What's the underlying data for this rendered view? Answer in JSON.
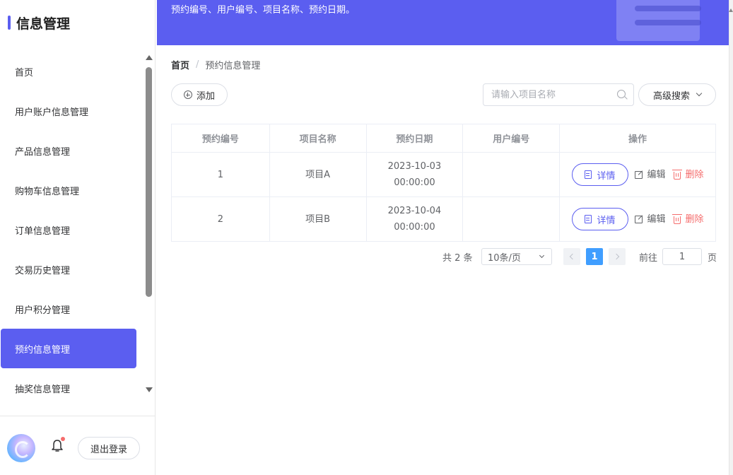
{
  "sidebar": {
    "title": "信息管理",
    "items": [
      {
        "label": "首页",
        "active": false
      },
      {
        "label": "用户账户信息管理",
        "active": false
      },
      {
        "label": "产品信息管理",
        "active": false
      },
      {
        "label": "购物车信息管理",
        "active": false
      },
      {
        "label": "订单信息管理",
        "active": false
      },
      {
        "label": "交易历史管理",
        "active": false
      },
      {
        "label": "用户积分管理",
        "active": false
      },
      {
        "label": "预约信息管理",
        "active": true
      },
      {
        "label": "抽奖信息管理",
        "active": false
      }
    ],
    "footer": {
      "logout_label": "退出登录"
    }
  },
  "banner": {
    "text": "预约编号、用户编号、项目名称、预约日期。"
  },
  "breadcrumb": {
    "home": "首页",
    "separator": "/",
    "current": "预约信息管理"
  },
  "toolbar": {
    "add_label": "添加",
    "search_placeholder": "请输入项目名称",
    "search_value": "",
    "advanced_label": "高级搜索"
  },
  "table": {
    "columns": [
      "预约编号",
      "项目名称",
      "预约日期",
      "用户编号",
      "操作"
    ],
    "rows": [
      {
        "id": "1",
        "project": "项目A",
        "date": "2023-10-03",
        "time": "00:00:00",
        "user": ""
      },
      {
        "id": "2",
        "project": "项目B",
        "date": "2023-10-04",
        "time": "00:00:00",
        "user": ""
      }
    ],
    "actions": {
      "detail": "详情",
      "edit": "编辑",
      "delete": "删除"
    }
  },
  "pagination": {
    "total_text": "共 2 条",
    "page_size": "10条/页",
    "current_page": "1",
    "goto_label": "前往",
    "goto_value": "1",
    "page_suffix": "页"
  },
  "colors": {
    "accent": "#5b5ef0",
    "page_active": "#409eff",
    "danger": "#f56c6c"
  }
}
